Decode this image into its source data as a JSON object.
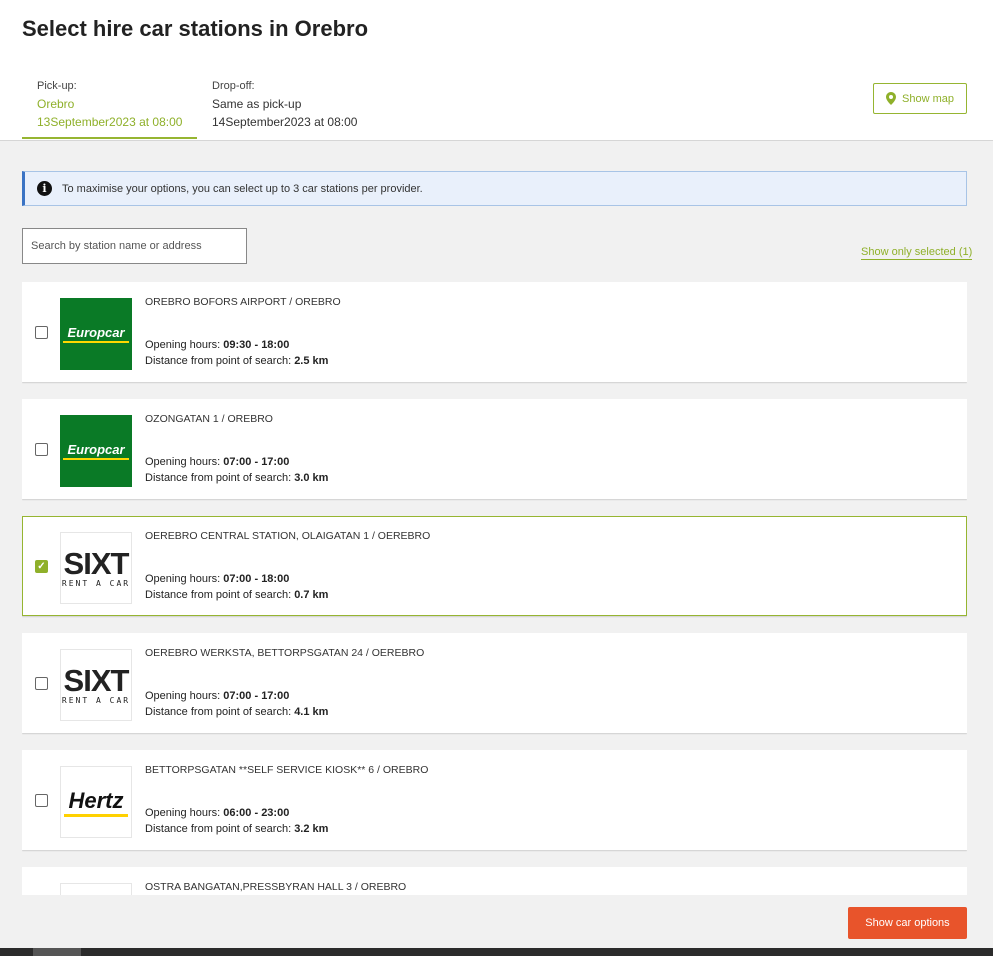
{
  "header": {
    "title_prefix": "Select hire car stations in ",
    "title_city": "Orebro",
    "pickup": {
      "label": "Pick-up:",
      "location": "Orebro",
      "datetime": "13September2023 at 08:00"
    },
    "dropoff": {
      "label": "Drop-off:",
      "location": "Same as pick-up",
      "datetime": "14September2023 at 08:00"
    },
    "map_button": {
      "label": "Show map",
      "icon": "map-pin-icon"
    }
  },
  "info": {
    "icon": "info-icon",
    "text": "To maximise your options, you can select up to 3 car stations per provider."
  },
  "search": {
    "placeholder": "Search by station name or address",
    "value": ""
  },
  "show_selected": "Show only selected (1)",
  "labels": {
    "hours": "Opening hours: ",
    "distance": "Distance from point of search: "
  },
  "stations": [
    {
      "provider": "Europcar",
      "name": "OREBRO BOFORS AIRPORT / OREBRO",
      "hours": "09:30 - 18:00",
      "distance": "2.5 km",
      "selected": false
    },
    {
      "provider": "Europcar",
      "name": "OZONGATAN 1 / OREBRO",
      "hours": "07:00 - 17:00",
      "distance": "3.0 km",
      "selected": false
    },
    {
      "provider": "Sixt",
      "name": "OEREBRO CENTRAL STATION, OLAIGATAN 1 / OEREBRO",
      "hours": "07:00 - 18:00",
      "distance": "0.7 km",
      "selected": true
    },
    {
      "provider": "Sixt",
      "name": "OEREBRO WERKSTA, BETTORPSGATAN 24 / OEREBRO",
      "hours": "07:00 - 17:00",
      "distance": "4.1 km",
      "selected": false
    },
    {
      "provider": "Hertz",
      "name": "BETTORPSGATAN **SELF SERVICE KIOSK** 6 / OREBRO",
      "hours": "06:00 - 23:00",
      "distance": "3.2 km",
      "selected": false
    },
    {
      "provider": "",
      "name": "OSTRA BANGATAN,PRESSBYRAN HALL 3 / OREBRO",
      "hours": "",
      "distance": "",
      "selected": false
    }
  ],
  "logos": {
    "europcar": "Europcar",
    "sixt": "SIXT",
    "sixt_sub": "RENT A CAR",
    "hertz": "Hertz"
  },
  "cta": "Show car options",
  "colors": {
    "accent": "#8fb02a",
    "cta": "#e8542b",
    "info_bg": "#e9f0fb",
    "europcar": "#0a7a26",
    "sixt_orange": "#ff5f00",
    "hertz_yellow": "#ffd100"
  }
}
